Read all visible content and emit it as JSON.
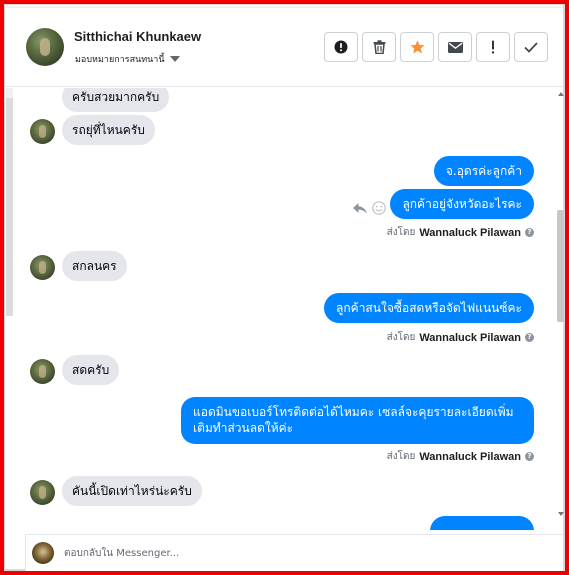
{
  "header": {
    "contact_name": "Sitthichai Khunkaew",
    "assign_label": "มอบหมายการสนทนานี้",
    "actions": [
      {
        "icon": "alert-circle-icon",
        "label": "Mark as spam"
      },
      {
        "icon": "trash-icon",
        "label": "Delete"
      },
      {
        "icon": "star-icon",
        "label": "Star"
      },
      {
        "icon": "envelope-icon",
        "label": "Mark as unread"
      },
      {
        "icon": "exclamation-icon",
        "label": "Follow up"
      },
      {
        "icon": "check-icon",
        "label": "Mark as done"
      }
    ]
  },
  "colors": {
    "accent": "#0084ff",
    "star": "#f7923a",
    "incoming_bubble": "#e4e6eb",
    "frame": "#ee0000"
  },
  "messages": [
    {
      "dir": "in",
      "text": "ครับสวยมากครับ",
      "avatar": false
    },
    {
      "dir": "in",
      "text": "รถยุ่ที่ไหนครับ",
      "avatar": true
    },
    {
      "dir": "out",
      "text": "จ.อุดรค่ะลูกค้า"
    },
    {
      "dir": "out",
      "text": "ลูกค้าอยู่จังหวัดอะไรคะ"
    },
    {
      "dir": "in",
      "text": "สกลนคร",
      "avatar": true
    },
    {
      "dir": "out",
      "text": "ลูกค้าสนใจซื้อสดหรือจัดไฟแนนซ์คะ"
    },
    {
      "dir": "in",
      "text": "สดครับ",
      "avatar": true
    },
    {
      "dir": "out",
      "lines": [
        "แอดมินขอเบอร์โทรติดต่อได้ไหมคะ เซลล์จะคุยรายละเอียดเพิ่ม",
        "เติมทำส่วนลดให้ค่ะ"
      ]
    },
    {
      "dir": "in",
      "text": "คันนี้เปิดเท่าไหร่น่ะครับ",
      "avatar": true
    }
  ],
  "sent_by": {
    "prefix": "ส่งโดย",
    "agent": "Wannaluck Pilawan",
    "help": "?"
  },
  "composer": {
    "placeholder": "ตอบกลับใน Messenger..."
  }
}
